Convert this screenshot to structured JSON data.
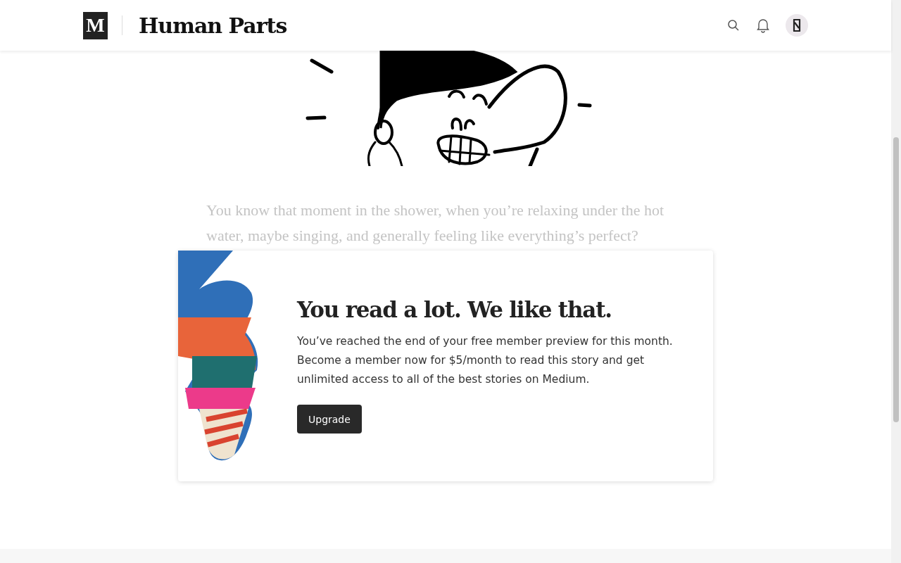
{
  "header": {
    "logo": "M",
    "publication": "Human Parts"
  },
  "article": {
    "intro": "You know that moment in the shower, when you’re relaxing under the hot water, maybe singing, and generally feeling like everything’s perfect?"
  },
  "paywall": {
    "heading": "You read a lot. We like that.",
    "message": "You’ve reached the end of your free member preview for this month. Become a member now for $5/month to read this story and get unlimited access to all of the best stories on Medium.",
    "button": "Upgrade"
  }
}
